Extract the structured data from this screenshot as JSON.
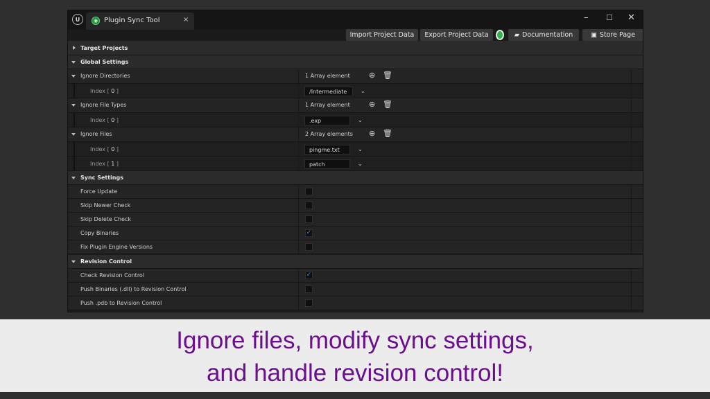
{
  "window": {
    "tab_title": "Plugin Sync Tool",
    "tab_close": "×",
    "controls": {
      "minimize": "–",
      "maximize": "☐",
      "close": "✕"
    }
  },
  "toolbar": {
    "import_label": "Import Project Data",
    "export_label": "Export Project Data",
    "docs_label": "Documentation",
    "store_label": "Store Page"
  },
  "details": {
    "target_projects": "Target Projects",
    "global_settings": "Global Settings",
    "ignore_directories": {
      "label": "Ignore Directories",
      "count": "1 Array element",
      "items": [
        {
          "prefix": "Index [ ",
          "index": "0",
          "suffix": " ]",
          "value": "/Intermediate"
        }
      ]
    },
    "ignore_file_types": {
      "label": "Ignore File Types",
      "count": "1 Array element",
      "items": [
        {
          "prefix": "Index [ ",
          "index": "0",
          "suffix": " ]",
          "value": ".exp"
        }
      ]
    },
    "ignore_files": {
      "label": "Ignore Files",
      "count": "2 Array elements",
      "items": [
        {
          "prefix": "Index [ ",
          "index": "0",
          "suffix": " ]",
          "value": "pingme.txt"
        },
        {
          "prefix": "Index [ ",
          "index": "1",
          "suffix": " ]",
          "value": "patch"
        }
      ]
    },
    "sync_settings": "Sync Settings",
    "sync_options": [
      {
        "label": "Force Update",
        "checked": false
      },
      {
        "label": "Skip Newer Check",
        "checked": false
      },
      {
        "label": "Skip Delete Check",
        "checked": false
      },
      {
        "label": "Copy Binaries",
        "checked": true
      },
      {
        "label": "Fix Plugin Engine Versions",
        "checked": false
      }
    ],
    "revision_control": "Revision Control",
    "revision_options": [
      {
        "label": "Check Revision Control",
        "checked": true
      },
      {
        "label": "Push Binaries (.dll) to Revision Control",
        "checked": false
      },
      {
        "label": "Push .pdb to Revision Control",
        "checked": false
      }
    ]
  },
  "caption": {
    "line1": "Ignore files, modify sync settings,",
    "line2": "and handle revision control!"
  },
  "colors": {
    "accent_check": "#3d8ee8",
    "status_green": "#2fb34a",
    "caption_text": "#6b0f8e"
  }
}
